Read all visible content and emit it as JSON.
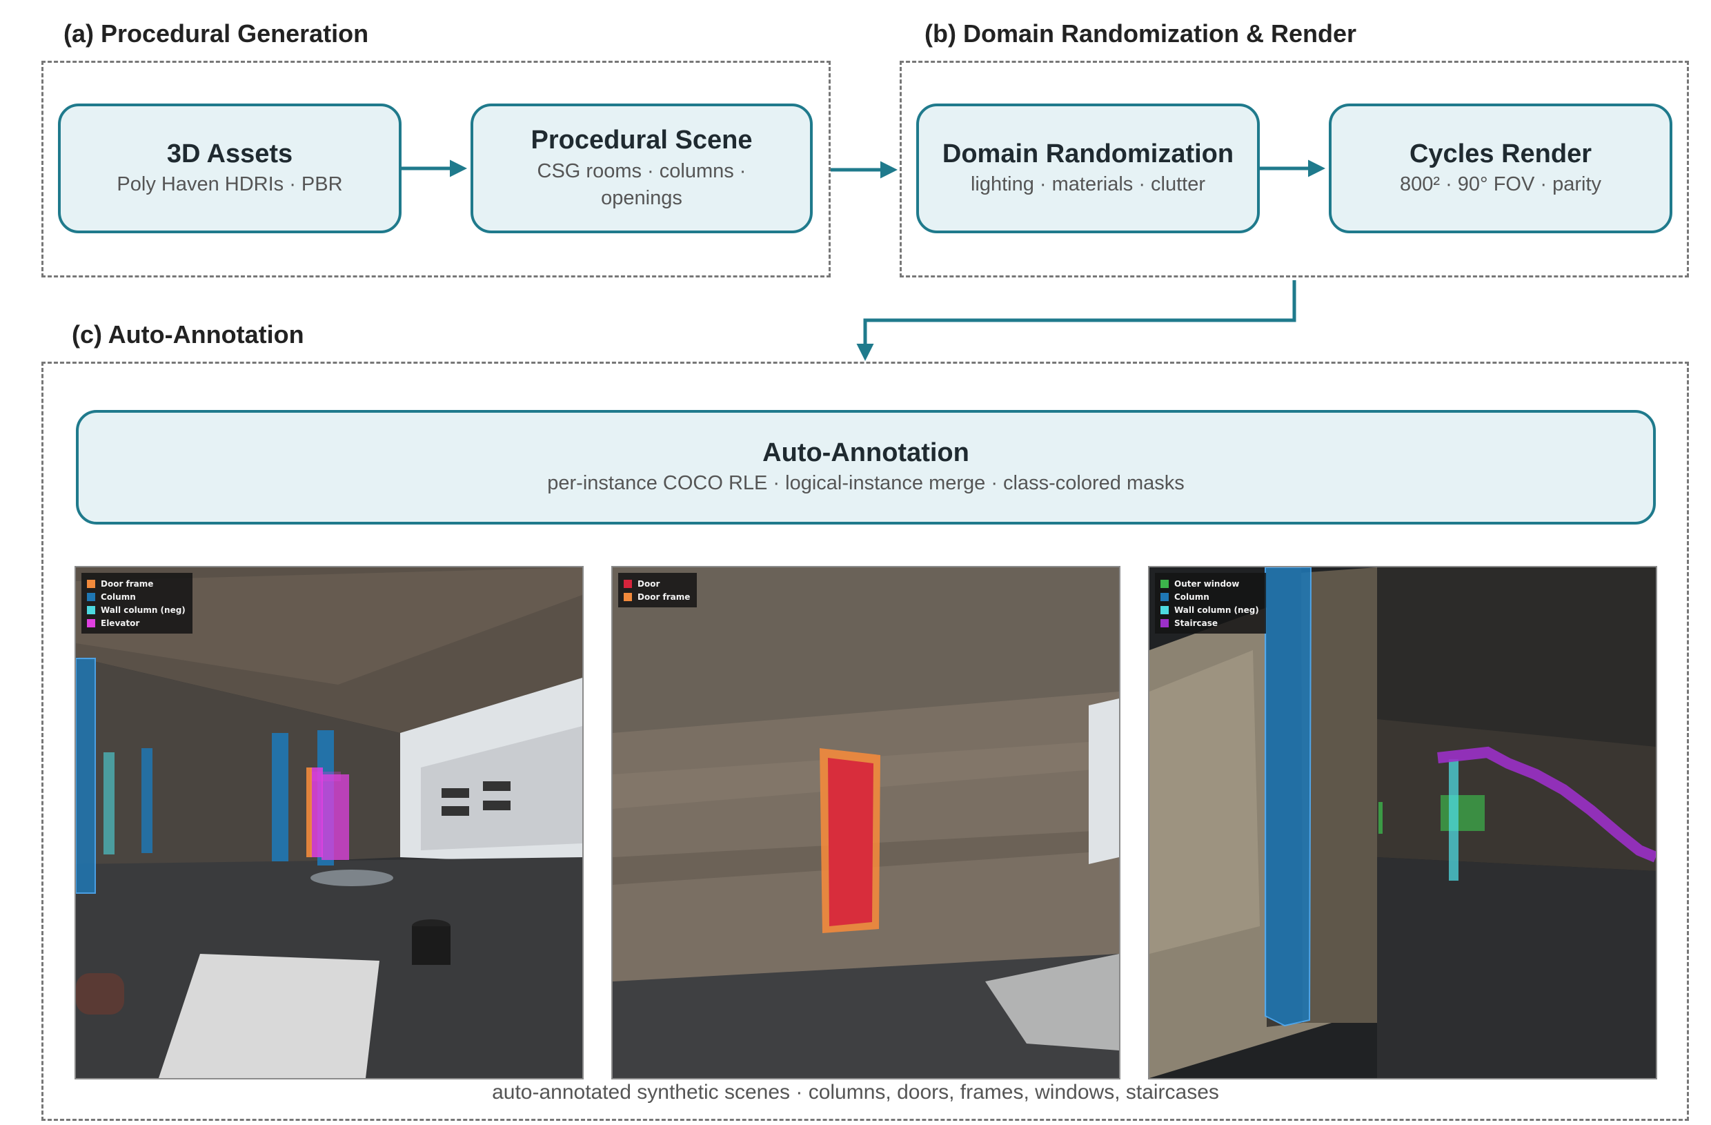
{
  "sections": {
    "a": "(a) Procedural Generation",
    "b": "(b) Domain Randomization & Render",
    "c": "(c) Auto-Annotation"
  },
  "nodes": {
    "assets": {
      "title": "3D Assets",
      "sub": "Poly Haven HDRIs · PBR"
    },
    "scene": {
      "title": "Procedural Scene",
      "sub1": "CSG rooms · columns ·",
      "sub2": "openings"
    },
    "dr": {
      "title": "Domain Randomization",
      "sub": "lighting · materials · clutter"
    },
    "render": {
      "title": "Cycles Render",
      "sub": "800² · 90° FOV · parity"
    },
    "annot": {
      "title": "Auto-Annotation",
      "sub": "per-instance COCO RLE · logical-instance merge · class-colored masks"
    }
  },
  "panels": [
    {
      "legend": [
        {
          "label": "Door frame",
          "color": "#f28a3c"
        },
        {
          "label": "Column",
          "color": "#1f77b4"
        },
        {
          "label": "Wall column (neg)",
          "color": "#4dd9e0"
        },
        {
          "label": "Elevator",
          "color": "#e040e0"
        }
      ]
    },
    {
      "legend": [
        {
          "label": "Door",
          "color": "#d6243c"
        },
        {
          "label": "Door frame",
          "color": "#f28a3c"
        }
      ]
    },
    {
      "legend": [
        {
          "label": "Outer window",
          "color": "#3cb44b"
        },
        {
          "label": "Column",
          "color": "#1f77b4"
        },
        {
          "label": "Wall column (neg)",
          "color": "#4dd9e0"
        },
        {
          "label": "Staircase",
          "color": "#9b30c8"
        }
      ]
    }
  ],
  "caption": "auto-annotated synthetic scenes · columns, doors, frames, windows, staircases",
  "colors": {
    "accent": "#1f7a8c",
    "node_fill": "#e6f2f5",
    "dashed_border": "#777777"
  }
}
